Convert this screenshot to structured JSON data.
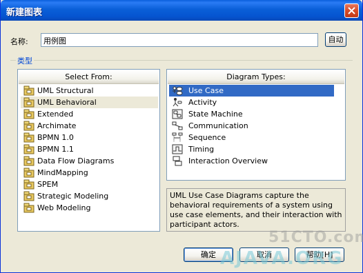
{
  "window": {
    "title": "新建图表"
  },
  "name_field": {
    "label": "名称:",
    "value": "用例图",
    "auto_button": "自动"
  },
  "group": {
    "label": "类型"
  },
  "select_from": {
    "header": "Select From:",
    "items": [
      {
        "label": "UML Structural"
      },
      {
        "label": "UML Behavioral"
      },
      {
        "label": "Extended"
      },
      {
        "label": "Archimate"
      },
      {
        "label": "BPMN 1.0"
      },
      {
        "label": "BPMN 1.1"
      },
      {
        "label": "Data Flow Diagrams"
      },
      {
        "label": "MindMapping"
      },
      {
        "label": "SPEM"
      },
      {
        "label": "Strategic Modeling"
      },
      {
        "label": "Web Modeling"
      }
    ],
    "selected": "UML Behavioral"
  },
  "diagram_types": {
    "header": "Diagram Types:",
    "items": [
      {
        "label": "Use Case",
        "icon": "use-case-icon"
      },
      {
        "label": "Activity",
        "icon": "activity-icon"
      },
      {
        "label": "State Machine",
        "icon": "state-machine-icon"
      },
      {
        "label": "Communication",
        "icon": "communication-icon"
      },
      {
        "label": "Sequence",
        "icon": "sequence-icon"
      },
      {
        "label": "Timing",
        "icon": "timing-icon"
      },
      {
        "label": "Interaction Overview",
        "icon": "interaction-overview-icon"
      }
    ],
    "selected": "Use Case"
  },
  "description": "UML Use Case Diagrams capture the behavioral requirements of a system using use case elements, and their interaction with participant actors.",
  "buttons": {
    "ok": "确定",
    "cancel": "取消",
    "help": "帮助[H]"
  },
  "watermarks": {
    "top": "51CTO.com",
    "bottom": "AJAVA.ORG"
  },
  "colors": {
    "titlebar": "#0a5fd8",
    "selection": "#316ac5",
    "dialog_bg": "#ece9d8",
    "group_label": "#0046d5"
  }
}
